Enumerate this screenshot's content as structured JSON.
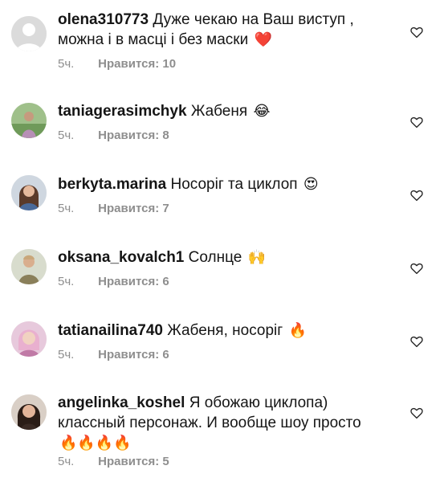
{
  "comments": [
    {
      "username": "olena310773",
      "text": "Дуже чекаю на Ваш виступ , можна і в масці і без маски",
      "emojis": "❤️",
      "time": "5ч.",
      "likes": "Нравится: 10",
      "avatar": "default-avatar",
      "like_icon": "heart-outline"
    },
    {
      "username": "taniagerasimchyk",
      "text": "Жабеня",
      "emojis": "😂",
      "time": "5ч.",
      "likes": "Нравится: 8",
      "avatar": "user-photo",
      "like_icon": "heart-outline"
    },
    {
      "username": "berkyta.marina",
      "text": "Носоріг та циклоп",
      "emojis": "😍",
      "time": "5ч.",
      "likes": "Нравится: 7",
      "avatar": "user-photo",
      "like_icon": "heart-outline"
    },
    {
      "username": "oksana_kovalch1",
      "text": "Солнце",
      "emojis": "🙌",
      "time": "5ч.",
      "likes": "Нравится: 6",
      "avatar": "user-photo",
      "like_icon": "heart-outline"
    },
    {
      "username": "tatianailina740",
      "text": "Жабеня, носоріг",
      "emojis": "🔥",
      "time": "5ч.",
      "likes": "Нравится: 6",
      "avatar": "user-photo",
      "like_icon": "heart-outline"
    },
    {
      "username": "angelinka_koshel",
      "text": "Я обожаю циклопа) классный персонаж. И вообще шоу просто",
      "emojis": "🔥🔥🔥🔥",
      "time": "5ч.",
      "likes": "Нравится: 5",
      "avatar": "user-photo",
      "like_icon": "heart-outline"
    }
  ]
}
